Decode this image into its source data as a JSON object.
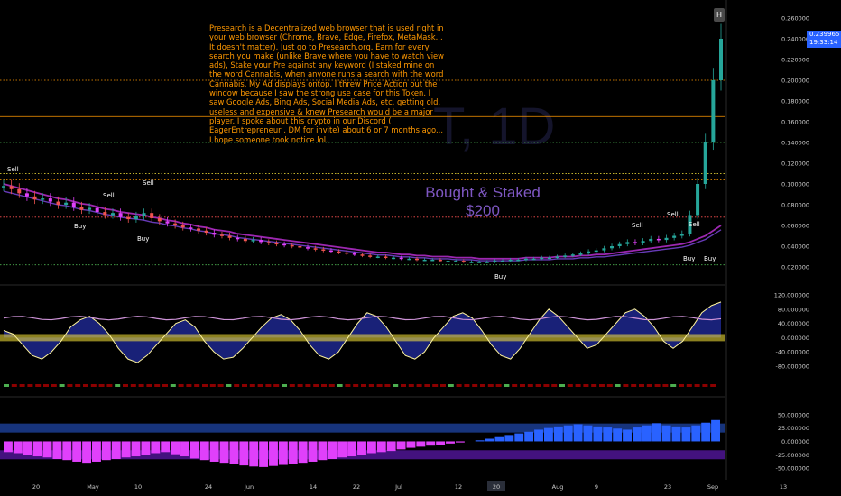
{
  "chart_data": {
    "type": "candlestick",
    "watermark": "T, 1D",
    "annotation_text": "Presearch is a Decentralized web browser that is used right in your web browser (Chrome, Brave, Edge, Firefox, MetaMask... It doesn't matter). Just go to Presearch.org. Earn for every search you make (unlike Brave where you have to watch view ads), Stake your Pre against any keyword (I staked mine on the word Cannabis, when anyone runs a search with the word Cannabis, My Ad displays ontop. I threw Price Action out the window because I saw the strong use case for this Token. I saw Google Ads, Bing Ads, Social Media Ads, etc. getting old, useless and expensive & knew Presearch would be a major player. I spoke about this crypto in our Discord ( EagerEntrepreneur , DM for invite) about 6 or 7 months ago... I hope someone took notice lol.",
    "big_label_line1": "Bought & Staked",
    "big_label_line2": "$200",
    "h_badge": "H",
    "current_price": "0.239965",
    "countdown": "19:33:14",
    "price_axis_ticks": [
      "0.260000",
      "0.240000",
      "0.220000",
      "0.200000",
      "0.180000",
      "0.160000",
      "0.140000",
      "0.120000",
      "0.100000",
      "0.080000",
      "0.060000",
      "0.040000",
      "0.020000"
    ],
    "price_ylim": [
      0.02,
      0.26
    ],
    "osc1_ticks": [
      "120.000000",
      "80.000000",
      "40.000000",
      "0.000000",
      "-40.000000",
      "-80.000000"
    ],
    "osc1_ylim": [
      -90,
      120
    ],
    "osc2_ticks": [
      "50.000000",
      "25.000000",
      "0.000000",
      "-25.000000",
      "-50.000000"
    ],
    "osc2_ylim": [
      -60,
      70
    ],
    "x_axis_labels": [
      "20",
      "May",
      "10",
      "24",
      "Jun",
      "14",
      "22",
      "Jul",
      "12",
      "20",
      "Aug",
      "9",
      "23",
      "Sep",
      "13"
    ],
    "highlighted_x_label": "20",
    "signal_labels": [
      {
        "text": "Sell",
        "type": "sell"
      },
      {
        "text": "Sell",
        "type": "sell"
      },
      {
        "text": "Sell",
        "type": "sell"
      },
      {
        "text": "Buy",
        "type": "buy"
      },
      {
        "text": "Buy",
        "type": "buy"
      },
      {
        "text": "Buy",
        "type": "buy"
      },
      {
        "text": "Sell",
        "type": "sell"
      },
      {
        "text": "Sell",
        "type": "sell"
      },
      {
        "text": "Sell",
        "type": "sell"
      },
      {
        "text": "Buy",
        "type": "buy"
      },
      {
        "text": "Buy",
        "type": "buy"
      }
    ],
    "horizontal_levels": [
      {
        "price": 0.2,
        "color": "#ff9800",
        "style": "dotted"
      },
      {
        "price": 0.165,
        "color": "#ff9800",
        "style": "solid"
      },
      {
        "price": 0.14,
        "color": "#4caf50",
        "style": "dotted"
      },
      {
        "price": 0.11,
        "color": "#ffeb3b",
        "style": "dotted"
      },
      {
        "price": 0.104,
        "color": "#ff9800",
        "style": "dotted"
      },
      {
        "price": 0.068,
        "color": "#ff5252",
        "style": "dotted"
      },
      {
        "price": 0.022,
        "color": "#4caf50",
        "style": "dotted"
      }
    ],
    "series": [
      {
        "name": "close",
        "values": [
          0.098,
          0.095,
          0.091,
          0.088,
          0.085,
          0.086,
          0.083,
          0.08,
          0.082,
          0.078,
          0.075,
          0.077,
          0.073,
          0.07,
          0.072,
          0.068,
          0.066,
          0.069,
          0.072,
          0.067,
          0.064,
          0.062,
          0.06,
          0.058,
          0.057,
          0.055,
          0.053,
          0.051,
          0.05,
          0.048,
          0.047,
          0.045,
          0.046,
          0.044,
          0.043,
          0.042,
          0.041,
          0.04,
          0.039,
          0.038,
          0.037,
          0.036,
          0.035,
          0.034,
          0.033,
          0.032,
          0.031,
          0.03,
          0.03,
          0.029,
          0.029,
          0.028,
          0.028,
          0.027,
          0.027,
          0.027,
          0.026,
          0.026,
          0.026,
          0.025,
          0.025,
          0.025,
          0.025,
          0.026,
          0.026,
          0.027,
          0.027,
          0.028,
          0.028,
          0.029,
          0.029,
          0.03,
          0.031,
          0.032,
          0.033,
          0.035,
          0.036,
          0.038,
          0.04,
          0.042,
          0.044,
          0.043,
          0.045,
          0.047,
          0.046,
          0.048,
          0.05,
          0.052,
          0.07,
          0.1,
          0.14,
          0.2,
          0.24
        ]
      },
      {
        "name": "ema",
        "values": [
          0.1,
          0.098,
          0.096,
          0.094,
          0.092,
          0.09,
          0.088,
          0.086,
          0.085,
          0.083,
          0.081,
          0.08,
          0.078,
          0.076,
          0.075,
          0.073,
          0.072,
          0.071,
          0.07,
          0.068,
          0.067,
          0.065,
          0.064,
          0.062,
          0.061,
          0.059,
          0.058,
          0.056,
          0.055,
          0.054,
          0.052,
          0.051,
          0.05,
          0.049,
          0.048,
          0.047,
          0.046,
          0.045,
          0.044,
          0.043,
          0.042,
          0.041,
          0.04,
          0.039,
          0.038,
          0.037,
          0.036,
          0.035,
          0.034,
          0.034,
          0.033,
          0.032,
          0.032,
          0.031,
          0.031,
          0.03,
          0.03,
          0.03,
          0.029,
          0.029,
          0.029,
          0.028,
          0.028,
          0.028,
          0.028,
          0.028,
          0.028,
          0.029,
          0.029,
          0.029,
          0.029,
          0.03,
          0.03,
          0.03,
          0.031,
          0.031,
          0.032,
          0.032,
          0.033,
          0.034,
          0.035,
          0.036,
          0.037,
          0.038,
          0.039,
          0.04,
          0.041,
          0.042,
          0.044,
          0.047,
          0.05,
          0.055,
          0.06
        ]
      },
      {
        "name": "osc1",
        "values": [
          20,
          10,
          -20,
          -50,
          -60,
          -40,
          -10,
          30,
          50,
          60,
          40,
          10,
          -30,
          -60,
          -70,
          -50,
          -20,
          10,
          40,
          50,
          30,
          -10,
          -40,
          -60,
          -55,
          -30,
          0,
          30,
          55,
          65,
          50,
          20,
          -20,
          -50,
          -60,
          -40,
          0,
          40,
          70,
          60,
          30,
          -10,
          -50,
          -60,
          -40,
          0,
          30,
          60,
          70,
          55,
          20,
          -20,
          -50,
          -60,
          -30,
          10,
          50,
          80,
          60,
          30,
          0,
          -30,
          -20,
          10,
          40,
          70,
          80,
          60,
          30,
          -10,
          -30,
          -10,
          30,
          70,
          90,
          100
        ]
      },
      {
        "name": "osc2",
        "values": [
          -20,
          -22,
          -25,
          -28,
          -30,
          -33,
          -35,
          -38,
          -40,
          -38,
          -35,
          -33,
          -30,
          -28,
          -25,
          -22,
          -20,
          -24,
          -28,
          -32,
          -35,
          -38,
          -40,
          -42,
          -45,
          -47,
          -48,
          -46,
          -44,
          -42,
          -40,
          -38,
          -35,
          -33,
          -30,
          -28,
          -25,
          -22,
          -20,
          -18,
          -15,
          -12,
          -10,
          -8,
          -6,
          -4,
          -2,
          0,
          2,
          5,
          8,
          12,
          15,
          18,
          22,
          25,
          28,
          30,
          32,
          30,
          28,
          26,
          24,
          22,
          26,
          30,
          34,
          30,
          28,
          26,
          30,
          35,
          40
        ]
      }
    ]
  },
  "colors": {
    "candle_up": "#26a69a",
    "candle_down": "#ef5350",
    "candle_purple": "#e040fb",
    "ema_purple": "#9c27b0",
    "ema_violet": "#673ab7",
    "fill_blue": "#1a237e",
    "fill_yellow": "#ffeb3b",
    "osc_line": "#ce93d8",
    "hist_blue": "#2962ff",
    "hist_magenta": "#e040fb"
  }
}
